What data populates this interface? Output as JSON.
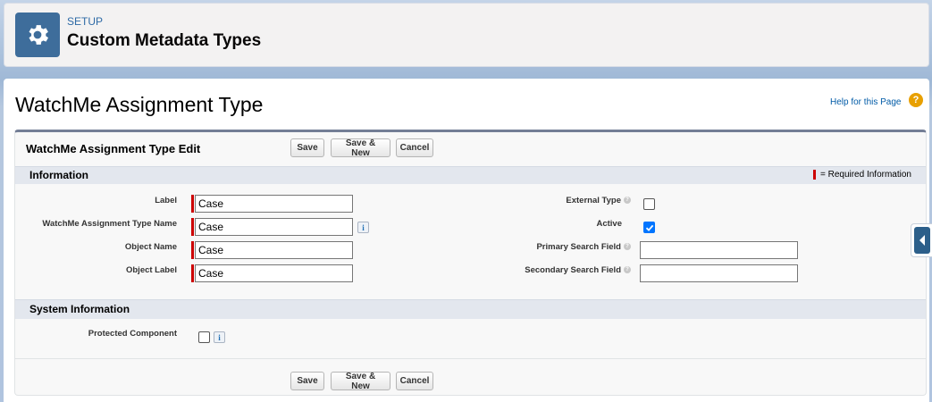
{
  "header": {
    "kicker": "SETUP",
    "title": "Custom Metadata Types"
  },
  "page": {
    "title": "WatchMe Assignment Type",
    "help_link": "Help for this Page",
    "help_icon": "?"
  },
  "edit": {
    "title": "WatchMe Assignment Type Edit",
    "buttons": {
      "save": "Save",
      "save_new": "Save & New",
      "cancel": "Cancel"
    }
  },
  "sections": {
    "information": {
      "title": "Information",
      "required_legend": "= Required Information",
      "left_fields": [
        {
          "label": "Label",
          "value": "Case",
          "required": true
        },
        {
          "label": "WatchMe Assignment Type Name",
          "value": "Case",
          "required": true,
          "info": "i"
        },
        {
          "label": "Object Name",
          "value": "Case",
          "required": true
        },
        {
          "label": "Object Label",
          "value": "Case",
          "required": true
        }
      ],
      "right_fields": [
        {
          "label": "External Type",
          "type": "checkbox",
          "checked": false,
          "help": "?"
        },
        {
          "label": "Active",
          "type": "checkbox",
          "checked": true
        },
        {
          "label": "Primary Search Field",
          "type": "text",
          "value": "",
          "help": "?"
        },
        {
          "label": "Secondary Search Field",
          "type": "text",
          "value": "",
          "help": "?"
        }
      ]
    },
    "system": {
      "title": "System Information",
      "protected_label": "Protected Component",
      "protected_checked": false,
      "info": "i"
    }
  },
  "colors": {
    "brand_icon": "#3e6d9b",
    "required": "#cc0000",
    "checkbox_checked": "#0075ff",
    "help_icon": "#e8a000"
  }
}
